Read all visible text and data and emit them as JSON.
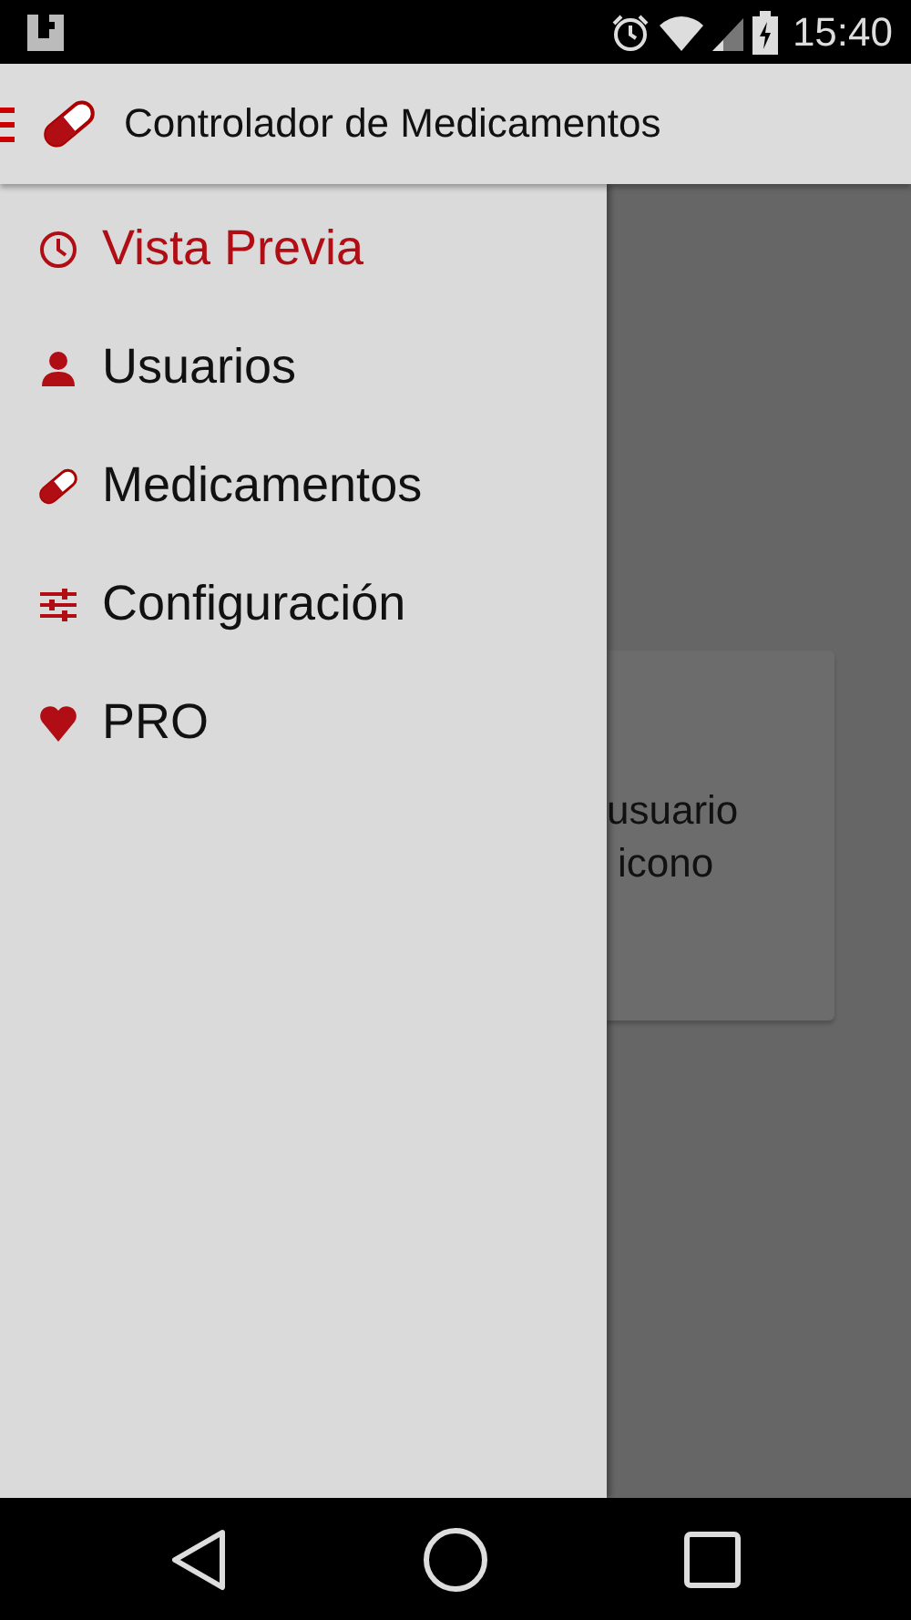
{
  "status_bar": {
    "time": "15:40"
  },
  "app_bar": {
    "title": "Controlador de Medicamentos"
  },
  "drawer": {
    "items": [
      {
        "label": "Vista Previa",
        "selected": true
      },
      {
        "label": "Usuarios",
        "selected": false
      },
      {
        "label": "Medicamentos",
        "selected": false
      },
      {
        "label": "Configuración",
        "selected": false
      },
      {
        "label": "PRO",
        "selected": false
      }
    ]
  },
  "background_card": {
    "lines": [
      "usuario",
      "icono"
    ]
  }
}
